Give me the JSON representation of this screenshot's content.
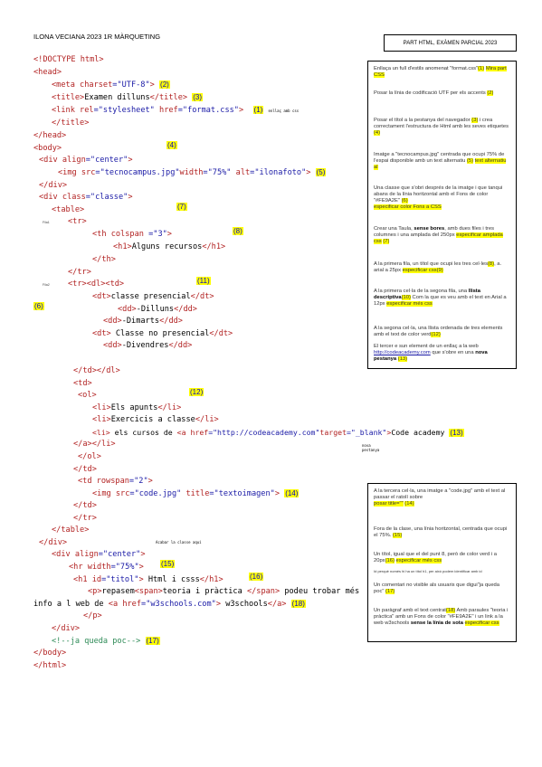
{
  "header": {
    "title": "ILONA VECIANA 2023 1R MÀRQUETING",
    "box": "PART HTML, EXÀMEN PARCIAL 2023"
  },
  "code": {
    "l1": "<!DOCTYPE html>",
    "l2": "<head>",
    "l3a": "<meta ",
    "l3b": "charset",
    "l3c": "=\"UTF-8\"",
    "l3d": ">",
    "l3n": "(2)",
    "l4a": "<title>",
    "l4b": "Examen dilluns",
    "l4c": "</title>",
    "l4n": "(3)",
    "l5a": "<link ",
    "l5b": "rel",
    "l5c": "=\"stylesheet\" ",
    "l5d": "href",
    "l5e": "=\"format.css\"",
    "l5f": ">",
    "l5n": "(1)",
    "l5s": "enllaç amb css",
    "l6": "</title>",
    "l7": "</head>",
    "l8": "<body>",
    "l8n": "(4)",
    "l9a": "<div ",
    "l9b": "align",
    "l9c": "=\"center\"",
    "l9d": ">",
    "l10a": "<img ",
    "l10b": "src",
    "l10c": "=\"tecnocampus.jpg\"",
    "l10d": "width",
    "l10e": "=\"75%\" ",
    "l10f": "alt",
    "l10g": "=\"ilonafoto\"",
    "l10h": ">",
    "l10n": "(5)",
    "l11": "</div>",
    "l12a": "<div ",
    "l12b": "class",
    "l12c": "=\"classe\"",
    "l12d": ">",
    "l13": "<table>",
    "l13n": "(7)",
    "fila1": "Fila1",
    "l14": "<tr>",
    "l15a": "<th ",
    "l15b": "colspan",
    "l15c": " =\"3\"",
    ">": ">",
    "l15n": "(8)",
    "l16a": "<h1>",
    "l16b": "Alguns recursos",
    "l16c": "</h1>",
    "l17": "</th>",
    "l18": "</tr>",
    "fila2": "Fila2",
    "l19": "<tr><dl><td>",
    "l19n": "(11)",
    "l20a": "<dt>",
    "l20b": "classe presencial",
    "l20c": "</dt>",
    "n6": "(6)",
    "l21a": "<dd>",
    "l21b": "-Dilluns",
    "l21c": "</dd>",
    "l22a": "<dd>",
    "l22b": "-Dimarts",
    "l22c": "</dd>",
    "l23a": "<dt>",
    "l23b": " Classe no presencial",
    "l23c": "</dt>",
    "l24a": "<dd>",
    "l24b": "-Divendres",
    "l24c": "</dd>",
    "l25": "</td></dl>",
    "l26": "<td>",
    "l27": "<ol>",
    "l27n": "(12)",
    "l28a": "<li>",
    "l28b": "Els apunts",
    "l28c": "</li>",
    "l29a": "<li>",
    "l29b": "Exercicis a classe",
    "l29c": "</li>",
    "l30a": "<li>",
    "l30b": " els cursos de ",
    "l30c": "<a ",
    "l30d": "href",
    "l30e": "=\"http://codeacademy.com\"",
    "l30f": "target",
    "l30g": "=\"_blank\"",
    "l30h": ">",
    "l30i": "Code academy ",
    "l30n": "(13)",
    "l31": "</a></li>",
    "l31s": "nova pestanya",
    "l32": "</ol>",
    "l33": "</td>",
    "l34a": "<td ",
    "l34b": "rowspan",
    "l34c": "=\"2\"",
    "l34d": ">",
    "l35a": "<img ",
    "l35b": "src",
    "l35c": "=\"code.jpg\" ",
    "l35d": "title",
    "l35e": "=\"textoimagen\"",
    "l35f": ">",
    "l35n": "(14)",
    "l36": "</td>",
    "l37": "</tr>",
    "l38": "</table>",
    "l39": "</div>",
    "l39s": "Acabar la classe aquí",
    "l40a": "<div ",
    "l40b": "align",
    "l40c": "=\"center\"",
    "l40d": ">",
    "l41a": "<hr ",
    "l41b": "width",
    "l41c": "=\"75%\"",
    "l41d": ">",
    "l41n": "(15)",
    "l42a": "<h1 ",
    "l42b": "id",
    "l42c": "=\"titol\"",
    "l42d": ">",
    "l42e": " Html i csss",
    "l42f": "</h1>",
    "l42n": "(16)",
    "l43a": "<p>",
    "l43b": "repasem",
    "l43c": "<span>",
    "l43d": "teoria i pràctica ",
    "l43e": "</span>",
    "l43f": " podeu trobar més",
    "l44a": "info a l web de ",
    "l44b": "<a ",
    "l44c": "href",
    "l44d": "=\"w3schools.com\"",
    "l44e": ">",
    "l44f": " w3schools",
    "l44g": "</a>",
    "l44n": "(18)",
    "l45": "</p>",
    "l46": "</div>",
    "l47": "<!--ja queda poc-->",
    "l47n": "(17)",
    "l48": "</body>",
    "l49": "</html>"
  },
  "panel1": {
    "i1a": "Enllaça un full d'estils anomenat \"format.css\"",
    "i1n": "(1)",
    "i1h": "Mira part CSS",
    "i2a": "Posar la línia de codificació UTF per els accents",
    "i2n": "(2)",
    "i3a": "Posar el títol a la pestanya del navegador",
    "i3n": "(3)",
    "i3b": "i crea correctament l'estructura de Html amb les seves etiquetes",
    "i3m": "(4)",
    "i4a": "Imatge a \"tecnocampus.jpg\" centrada que ocupi 75% de l'espai disponible amb un text alternatiu",
    "i4n": "(5)",
    "i4h": "text alternatiu al",
    "i5a": "Una classe que s'obri després de la imatge i que tanqui abans de la línia horitzontal amb el Fons de color \"#FE9A2E\"",
    "i5n": "(6)",
    "i5h": "especificar color Fons a CSS",
    "i6a": "Crear una Taula, ",
    "i6b": "sense bores",
    "i6c": ", amb dues files i tres columnes i una amplada del 250px",
    "i6h": "especificar amplada css",
    "i6n": "(7)",
    "i7a": "A la primera fila, un títol que ocupi les tres cel·les",
    "i7n": "(8)",
    "i7b": ", a. arial a 25px",
    "i7h": "especificar css",
    "i7m": "(9)",
    "i8a": "A la primera cel·la de la segona fila, una ",
    "i8b": "llista descriptiva",
    "i8n": "(10)",
    "i8c": " Com la que es veu amb el text en Arial a 12px",
    "i8h": "especificar més css",
    "i9a": "A la segona cel·la, una llista ordenada de tres elements amb el text de color verd",
    "i9n": "(12)",
    "i10a": "El tercer e sun element de un enllaç a la web ",
    "i10l": "http://codeacademy.com",
    "i10b": " que s'obre en una ",
    "i10c": "nova pestanya",
    "i10n": "(13)"
  },
  "panel2": {
    "j1a": "A la tercera cel·la, una imatge a \"code.jpg\" amb el text al passar el ratolí sobre",
    "j1h": "posar title=\"\"",
    "j1n": "(14)",
    "j2a": "Fora de la clase, una línia horitzontal, centrada que ocupi el 75%.",
    "j2n": "(15)",
    "j3a": "Un títol, igual que el del punt 8, però de color verd i a 20px",
    "j3n": "(16)",
    "j3h": "especificar més css",
    "j3s": "Id perquè només hi ha un títol h1, per això podem identificar amb id",
    "j4a": "Un comentari no visible als usuaris que digui\"ja queda poc\"",
    "j4n": "(17)",
    "j5a": "Un paràgraf amb el text centrat",
    "j5n": "(18)",
    "j5b": "Amb paraules \"teoria i pràctica\" amb un Fons de color \"#FE9A2E\" i un link a la web w3schools ",
    "j5c": "sense la línia de sota",
    "j5h": "especificar css"
  }
}
